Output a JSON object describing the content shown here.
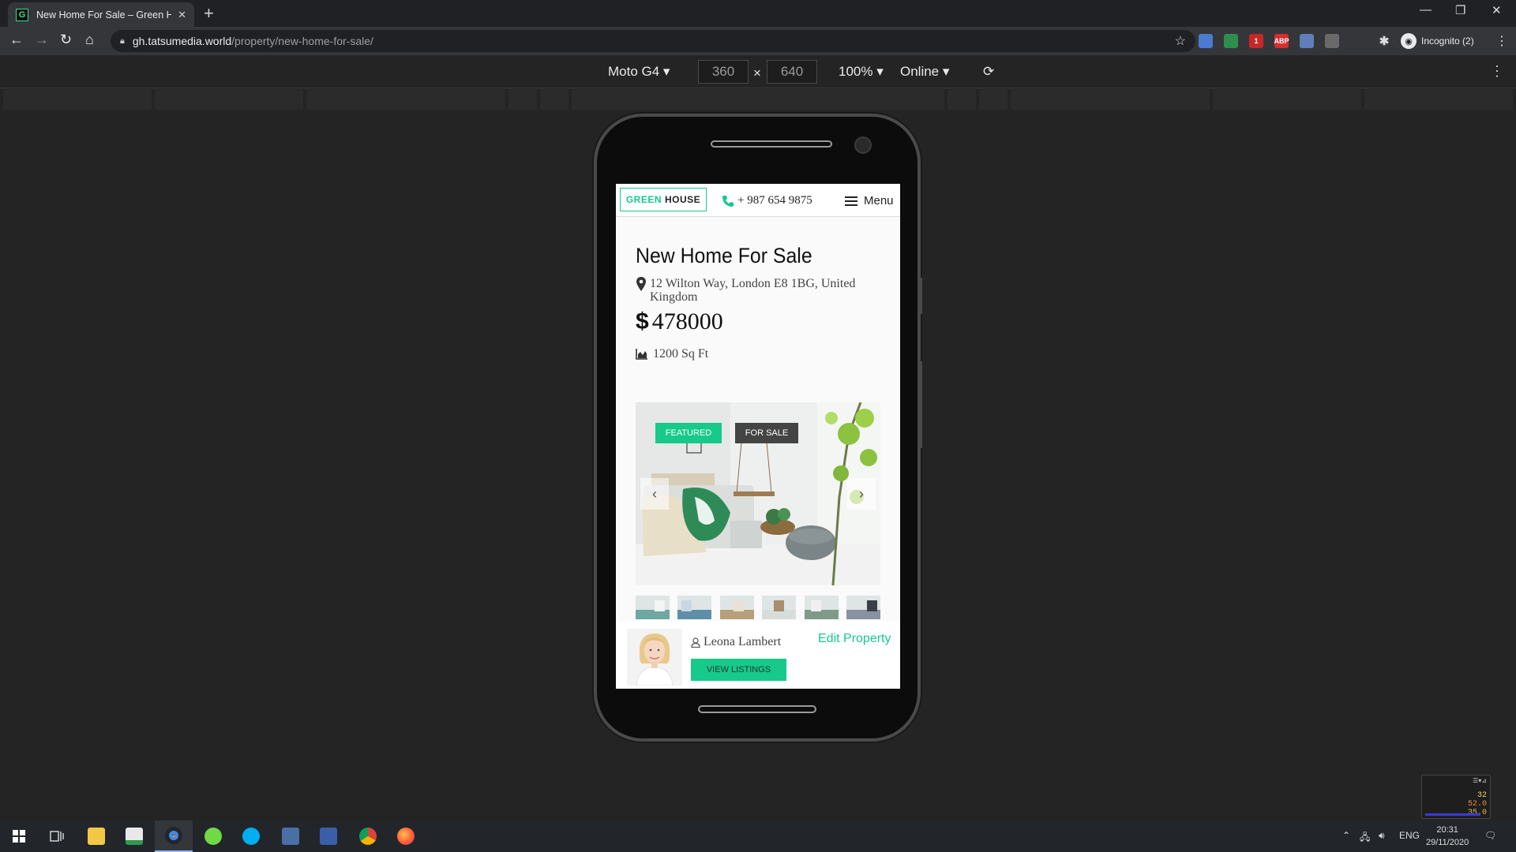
{
  "browser": {
    "tab_title": "New Home For Sale – Green Hou",
    "favicon_letter": "G",
    "url_host": "gh.tatsumedia.world",
    "url_path": "/property/new-home-for-sale/",
    "profile_label": "Incognito (2)",
    "extensions": [
      {
        "name": "translate-icon",
        "color": "#4a7bd0",
        "text": ""
      },
      {
        "name": "chart-icon",
        "color": "#2f8d4e",
        "text": ""
      },
      {
        "name": "calendar-icon",
        "color": "#c62828",
        "text": "1"
      },
      {
        "name": "adblock-icon",
        "color": "#d32f2f",
        "text": "ABP"
      },
      {
        "name": "link-icon",
        "color": "#5e7fb8",
        "text": ""
      },
      {
        "name": "tool-icon",
        "color": "#6a6a6a",
        "text": ""
      }
    ]
  },
  "devtools": {
    "device": "Moto G4",
    "width": "360",
    "times": "×",
    "height": "640",
    "zoom": "100%",
    "network": "Online"
  },
  "site": {
    "logo_green": "GREEN",
    "logo_dark": "HOUSE",
    "phone": "+ 987 654 9875",
    "menu_label": "Menu"
  },
  "property": {
    "title": "New Home For Sale",
    "address": "12 Wilton Way, London E8 1BG, United Kingdom",
    "currency_symbol": "$",
    "price": "478000",
    "area": "1200 Sq Ft",
    "badges": {
      "featured": "FEATURED",
      "for_sale": "FOR SALE"
    },
    "thumb_count": 6
  },
  "agent": {
    "name": "Leona Lambert",
    "view_listings": "VIEW LISTINGS",
    "edit_property": "Edit Property"
  },
  "perf": {
    "v1": "32",
    "v2": "52.0",
    "v3": "35.0"
  },
  "taskbar": {
    "lang": "ENG",
    "time": "20:31",
    "date": "29/11/2020"
  },
  "colors": {
    "accent": "#17c98a",
    "for_sale_badge": "#444444"
  }
}
